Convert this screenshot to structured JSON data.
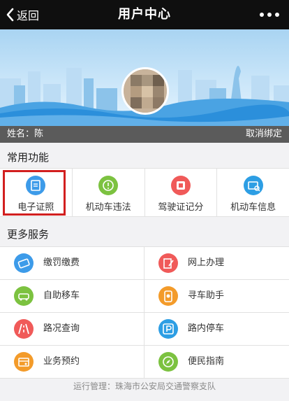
{
  "header": {
    "back_label": "返回",
    "title": "用户中心"
  },
  "profile": {
    "name_label": "姓名：陈",
    "unbind_label": "取消绑定"
  },
  "common_section": {
    "title": "常用功能",
    "items": [
      {
        "label": "电子证照",
        "icon": "id-card-icon",
        "color": "#3d9be9"
      },
      {
        "label": "机动车违法",
        "icon": "vehicle-violation-icon",
        "color": "#7cc240"
      },
      {
        "label": "驾驶证记分",
        "icon": "license-points-icon",
        "color": "#f05a59"
      },
      {
        "label": "机动车信息",
        "icon": "vehicle-info-icon",
        "color": "#2d9ee4"
      }
    ]
  },
  "more_section": {
    "title": "更多服务",
    "items": [
      {
        "label": "缴罚缴费",
        "icon": "payment-card-icon",
        "color": "#3d9be9"
      },
      {
        "label": "网上办理",
        "icon": "online-handle-icon",
        "color": "#f05a59"
      },
      {
        "label": "自助移车",
        "icon": "move-car-icon",
        "color": "#7cc240"
      },
      {
        "label": "寻车助手",
        "icon": "find-car-icon",
        "color": "#f39b2a"
      },
      {
        "label": "路况查询",
        "icon": "road-condition-icon",
        "color": "#f05a59"
      },
      {
        "label": "路内停车",
        "icon": "parking-icon",
        "color": "#2d9ee4"
      },
      {
        "label": "业务预约",
        "icon": "appointment-icon",
        "color": "#f39b2a"
      },
      {
        "label": "便民指南",
        "icon": "compass-icon",
        "color": "#7cc240"
      }
    ]
  },
  "footer": {
    "text": "运行管理：珠海市公安局交通警察支队"
  }
}
